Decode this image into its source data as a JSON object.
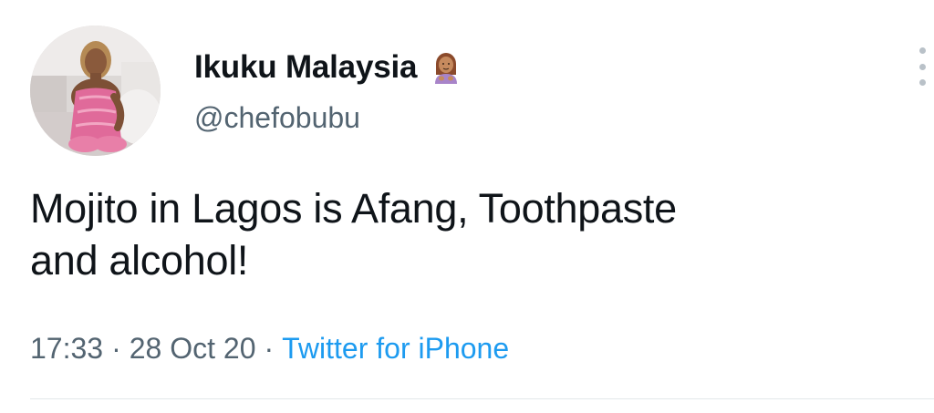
{
  "tweet": {
    "author": {
      "display_name": "Ikuku Malaysia",
      "handle": "@chefobubu",
      "name_emoji": "person-gesturing-emoji"
    },
    "text_line1": "Mojito in Lagos is Afang, Toothpaste",
    "text_line2": "and alcohol!",
    "time": "17:33",
    "separator": "·",
    "date": "28 Oct 20",
    "source": "Twitter for iPhone"
  },
  "icons": {
    "more": "more-vertical-icon",
    "avatar": "profile-photo"
  },
  "colors": {
    "text_primary": "#0f1419",
    "text_secondary": "#536471",
    "link": "#1d9bf0",
    "divider": "#e3e7ea"
  }
}
